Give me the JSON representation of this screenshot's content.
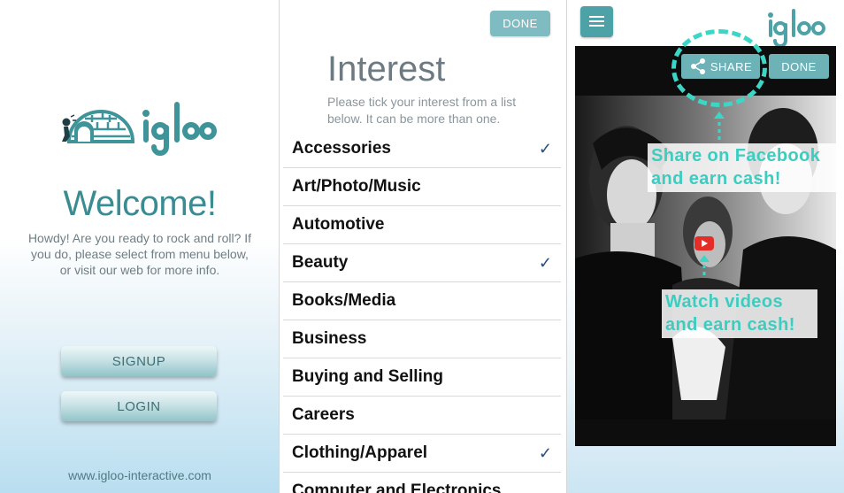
{
  "welcome_screen": {
    "logo_text": "igloo",
    "title": "Welcome!",
    "message": "Howdy! Are you ready to rock and roll? If you do, please select from menu below, or visit our web for more info.",
    "signup_label": "SIGNUP",
    "login_label": "LOGIN",
    "website": "www.igloo-interactive.com"
  },
  "interest_screen": {
    "done_label": "DONE",
    "title": "Interest",
    "subtitle": "Please tick your interest from a list below. It can be more than one.",
    "items": [
      {
        "label": "Accessories",
        "checked": true
      },
      {
        "label": "Art/Photo/Music",
        "checked": false
      },
      {
        "label": "Automotive",
        "checked": false
      },
      {
        "label": "Beauty",
        "checked": true
      },
      {
        "label": "Books/Media",
        "checked": false
      },
      {
        "label": "Business",
        "checked": false
      },
      {
        "label": "Buying and Selling",
        "checked": false
      },
      {
        "label": "Careers",
        "checked": false
      },
      {
        "label": "Clothing/Apparel",
        "checked": true
      },
      {
        "label": "Computer and Electronics",
        "checked": false
      }
    ],
    "check_mark": "✓"
  },
  "video_screen": {
    "logo_text": "igloo",
    "share_label": "SHARE",
    "done_label": "DONE",
    "share_callout_line1": "Share on Facebook",
    "share_callout_line2": "and earn cash!",
    "video_callout_line1": "Watch videos",
    "video_callout_line2": "and earn cash!"
  },
  "icons": [
    "igloo-logo-icon",
    "menu-icon",
    "share-icon",
    "youtube-play-icon",
    "checkmark-icon"
  ],
  "colors": {
    "brand_teal": "#4da2a8",
    "button_teal": "#6cb2b7",
    "callout_cyan": "#3dcdc0",
    "youtube_red": "#e52d27"
  }
}
